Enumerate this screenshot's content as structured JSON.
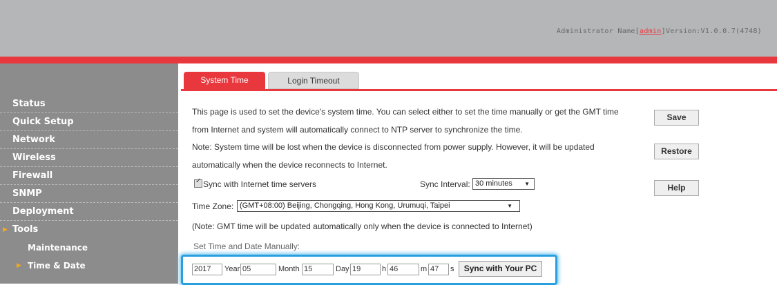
{
  "header": {
    "admin_prefix": "Administrator Name[",
    "admin_name": "admin",
    "admin_suffix": "]",
    "version": "Version:V1.0.0.7(4748)"
  },
  "colors": {
    "accent": "#e8383d",
    "header_bg": "#b5b6b8",
    "sidebar_bg": "#8c8c8c",
    "highlight_border": "#28a0e0",
    "marker": "#f5a623"
  },
  "sidebar": {
    "items": [
      {
        "label": "Status"
      },
      {
        "label": "Quick Setup"
      },
      {
        "label": "Network"
      },
      {
        "label": "Wireless"
      },
      {
        "label": "Firewall"
      },
      {
        "label": "SNMP"
      },
      {
        "label": "Deployment"
      },
      {
        "label": "Tools",
        "active": true
      }
    ],
    "sub_items": [
      {
        "label": "Maintenance"
      },
      {
        "label": "Time & Date",
        "active": true
      }
    ],
    "marker_icon": "triangle-right-icon"
  },
  "tabs": [
    {
      "label": "System Time",
      "active": true
    },
    {
      "label": "Login Timeout",
      "active": false
    }
  ],
  "main": {
    "intro_line1": "This page is used to set the device's system time. You can select either to set the time manually or get the GMT time",
    "intro_line2": "from Internet and system will automatically connect to NTP server to synchronize the time.",
    "note_line1": "Note: System time will be lost when the device is disconnected from power supply. However, it will be updated",
    "note_line2": "automatically when the device reconnects to Internet.",
    "sync_checkbox_label": "Sync with Internet time servers",
    "sync_checked": true,
    "sync_interval_label": "Sync Interval:",
    "sync_interval_value": "30 minutes",
    "timezone_label": "Time Zone:",
    "timezone_value": "(GMT+08:00) Beijing, Chongqing, Hong Kong, Urumuqi, Taipei",
    "gmt_note": "(Note: GMT time will be updated automatically only when the device is connected to Internet)",
    "manual_title": "Set Time and Date Manually:"
  },
  "manual": {
    "year": {
      "value": "2017",
      "unit": "Year"
    },
    "month": {
      "value": "05",
      "unit": "Month"
    },
    "day": {
      "value": "15",
      "unit": "Day"
    },
    "hour": {
      "value": "19",
      "unit": "h"
    },
    "minute": {
      "value": "46",
      "unit": "m"
    },
    "second": {
      "value": "47",
      "unit": "s"
    },
    "sync_pc_label": "Sync with Your PC"
  },
  "buttons": {
    "save": "Save",
    "restore": "Restore",
    "help": "Help"
  }
}
